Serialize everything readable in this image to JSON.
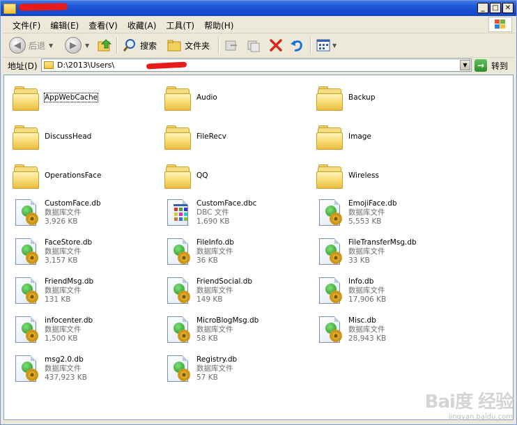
{
  "menu": [
    "文件(F)",
    "编辑(E)",
    "查看(V)",
    "收藏(A)",
    "工具(T)",
    "帮助(H)"
  ],
  "toolbar": {
    "back_label": "后退",
    "search_label": "搜索",
    "folders_label": "文件夹"
  },
  "address": {
    "label": "地址(D)",
    "path": "D:\\2013\\Users\\",
    "go_label": "转到"
  },
  "folders": [
    {
      "name": "AppWebCache",
      "selected": true
    },
    {
      "name": "Audio"
    },
    {
      "name": "Backup"
    },
    {
      "name": "DiscussHead"
    },
    {
      "name": "FileRecv"
    },
    {
      "name": "Image"
    },
    {
      "name": "OperationsFace"
    },
    {
      "name": "QQ"
    },
    {
      "name": "Wireless"
    }
  ],
  "files": [
    {
      "name": "CustomFace.db",
      "type": "数据库文件",
      "size": "3,926 KB",
      "icon": "db"
    },
    {
      "name": "CustomFace.dbc",
      "type": "DBC 文件",
      "size": "1,690 KB",
      "icon": "dbc"
    },
    {
      "name": "EmojiFace.db",
      "type": "数据库文件",
      "size": "5,553 KB",
      "icon": "db"
    },
    {
      "name": "FaceStore.db",
      "type": "数据库文件",
      "size": "3,157 KB",
      "icon": "db"
    },
    {
      "name": "FileInfo.db",
      "type": "数据库文件",
      "size": "36 KB",
      "icon": "db"
    },
    {
      "name": "FileTransferMsg.db",
      "type": "数据库文件",
      "size": "33 KB",
      "icon": "db"
    },
    {
      "name": "FriendMsg.db",
      "type": "数据库文件",
      "size": "131 KB",
      "icon": "db"
    },
    {
      "name": "FriendSocial.db",
      "type": "数据库文件",
      "size": "149 KB",
      "icon": "db"
    },
    {
      "name": "Info.db",
      "type": "数据库文件",
      "size": "17,906 KB",
      "icon": "db"
    },
    {
      "name": "infocenter.db",
      "type": "数据库文件",
      "size": "1,500 KB",
      "icon": "db"
    },
    {
      "name": "MicroBlogMsg.db",
      "type": "数据库文件",
      "size": "58 KB",
      "icon": "db"
    },
    {
      "name": "Misc.db",
      "type": "数据库文件",
      "size": "28,943 KB",
      "icon": "db"
    },
    {
      "name": "msg2.0.db",
      "type": "数据库文件",
      "size": "437,923 KB",
      "icon": "db"
    },
    {
      "name": "Registry.db",
      "type": "数据库文件",
      "size": "57 KB",
      "icon": "db"
    }
  ],
  "watermark": {
    "logo": "Bai度 经验",
    "url": "jingyan.baidu.com"
  }
}
